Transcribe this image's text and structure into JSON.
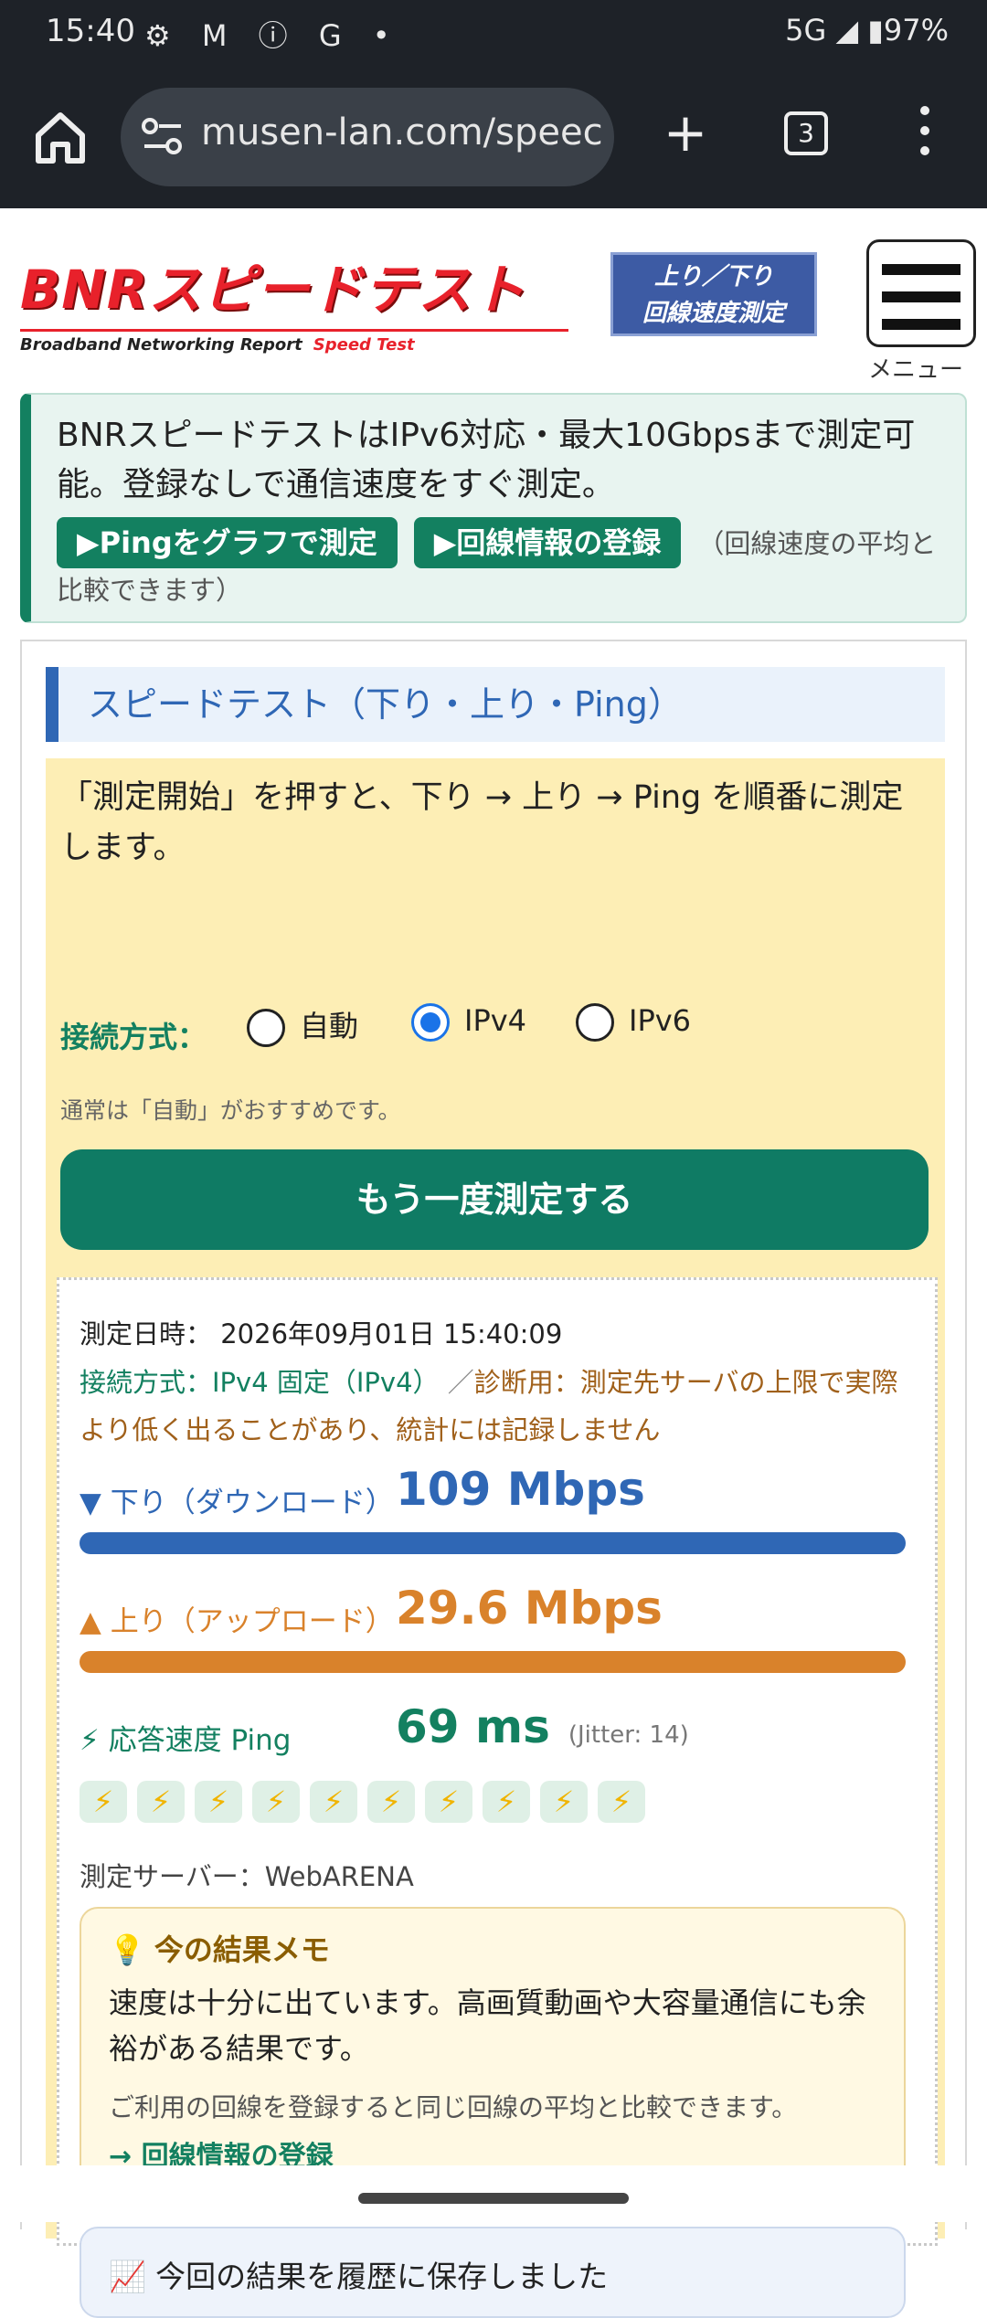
{
  "status": {
    "time": "15:40",
    "icons": "⚙ M ⓘ G •",
    "network": "5G",
    "battery": "97%"
  },
  "browser": {
    "url": "musen-lan.com/speec",
    "tab_count": "3",
    "new_tab_glyph": "+"
  },
  "header": {
    "logo_main": "BNRスピードテスト",
    "logo_sub": "Broadband Networking Report",
    "logo_sub2": "Speed Test",
    "badge_line1": "上り／下り",
    "badge_line2": "回線速度測定",
    "menu_label": "メニュー"
  },
  "info": {
    "text": "BNRスピードテストはIPv6対応・最大10Gbpsまで測定可能。登録なしで通信速度をすぐ測定。",
    "btn_ping": "▶Pingをグラフで測定",
    "btn_register": "▶回線情報の登録",
    "note": "（回線速度の平均と比較できます）"
  },
  "section": {
    "title": "スピードテスト（下り・上り・Ping）",
    "intro": "「測定開始」を押すと、下り → 上り → Ping を順番に測定します。",
    "conn_label": "接続方式：",
    "options": [
      "自動",
      "IPv4",
      "IPv6"
    ],
    "selected": "IPv4",
    "hint": "通常は「自動」がおすすめです。",
    "retest_button": "もう一度測定する"
  },
  "result": {
    "datetime": "測定日時： 2026年09月01日 15:40:09",
    "conn_info": "接続方式：IPv4 固定（IPv4）",
    "separator": "／",
    "diag": "診断用：測定先サーバの上限で実際より低く出ることがあり、統計には記録しません",
    "download_label": "▼ 下り（ダウンロード）",
    "download_value": "109 Mbps",
    "upload_label": "▲ 上り（アップロード）",
    "upload_value": "29.6 Mbps",
    "ping_label": "⚡ 応答速度 Ping",
    "ping_value": "69 ms",
    "jitter": "(Jitter: 14)",
    "bolt_count": 10,
    "server": "測定サーバー：WebARENA",
    "colors": {
      "download": "#2f67b5",
      "upload": "#d9822b",
      "ping": "#138060"
    }
  },
  "memo": {
    "title": "今の結果メモ",
    "body": "速度は十分に出ています。高画質動画や大容量通信にも余裕がある結果です。",
    "note": "ご利用の回線を登録すると同じ回線の平均と比較できます。",
    "link": "→ 回線情報の登録"
  },
  "history": {
    "text": "今回の結果を履歴に保存しました"
  }
}
